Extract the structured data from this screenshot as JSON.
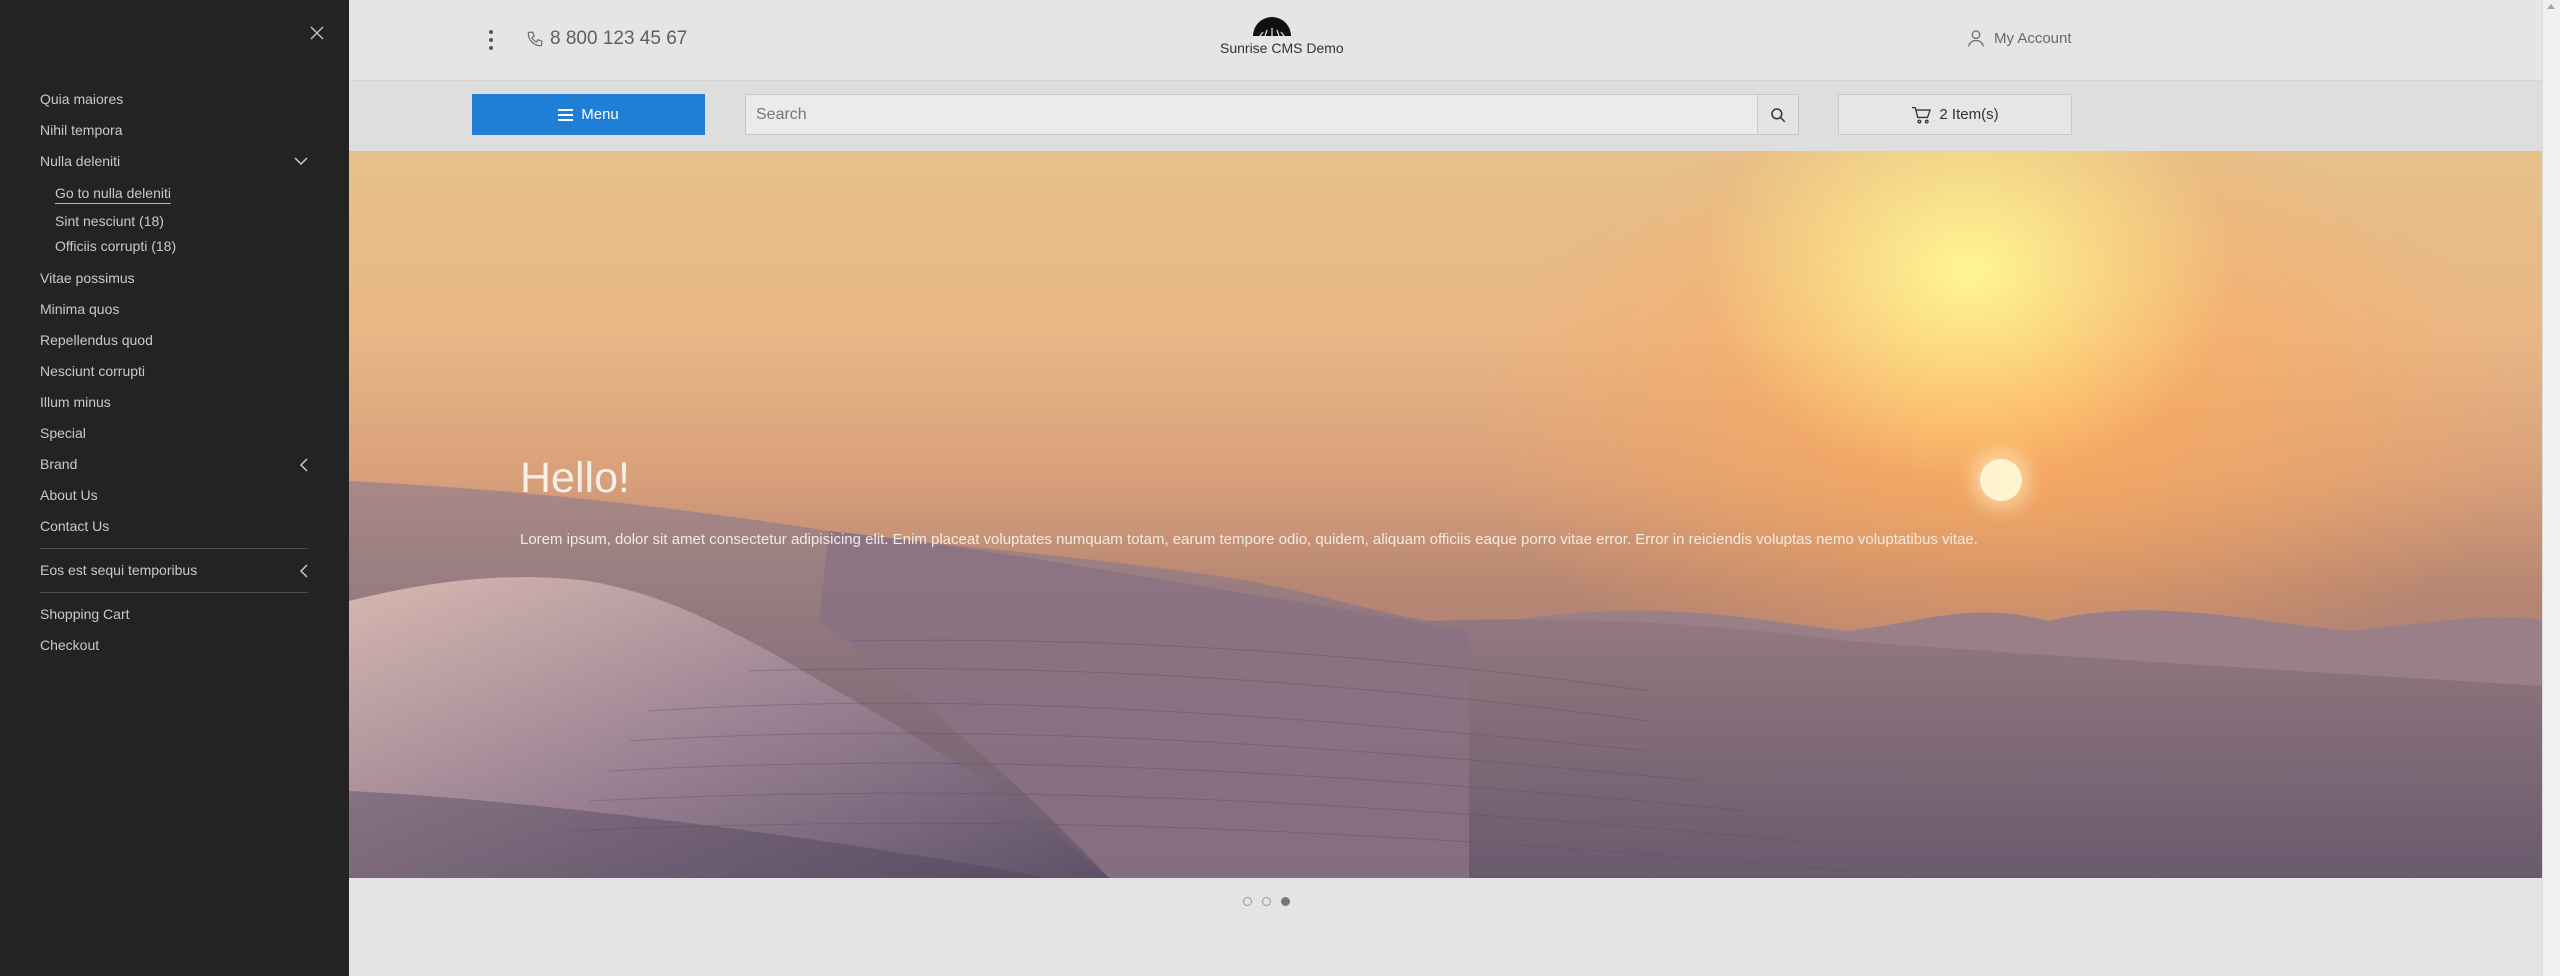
{
  "header": {
    "phone": "8 800 123 45 67",
    "site_name": "Sunrise CMS Demo",
    "account_label": "My Account"
  },
  "navbar": {
    "menu_label": "Menu",
    "search_placeholder": "Search",
    "cart_label": "2 Item(s)"
  },
  "hero": {
    "title": "Hello!",
    "text": "Lorem ipsum, dolor sit amet consectetur adipisicing elit. Enim placeat voluptates numquam totam, earum tempore odio, quidem, aliquam officiis eaque porro vitae error. Error in reiciendis voluptas nemo voluptatibus vitae.",
    "slides": 3,
    "active_slide": 3
  },
  "drawer": {
    "items": [
      {
        "label": "Quia maiores"
      },
      {
        "label": "Nihil tempora"
      },
      {
        "label": "Nulla deleniti",
        "expanded": true,
        "children": [
          "Go to nulla deleniti",
          "Sint nesciunt (18)",
          "Officiis corrupti (18)"
        ]
      },
      {
        "label": "Vitae possimus"
      },
      {
        "label": "Minima quos"
      },
      {
        "label": "Repellendus quod"
      },
      {
        "label": "Nesciunt corrupti"
      },
      {
        "label": "Illum minus"
      },
      {
        "label": "Special"
      },
      {
        "label": "Brand"
      },
      {
        "label": "About Us"
      },
      {
        "label": "Contact Us"
      }
    ],
    "secondary": [
      "Eos est sequi temporibus"
    ],
    "footer": [
      "Shopping Cart",
      "Checkout"
    ]
  },
  "colors": {
    "accent": "#1f7fd6",
    "drawer_bg": "#232323"
  }
}
